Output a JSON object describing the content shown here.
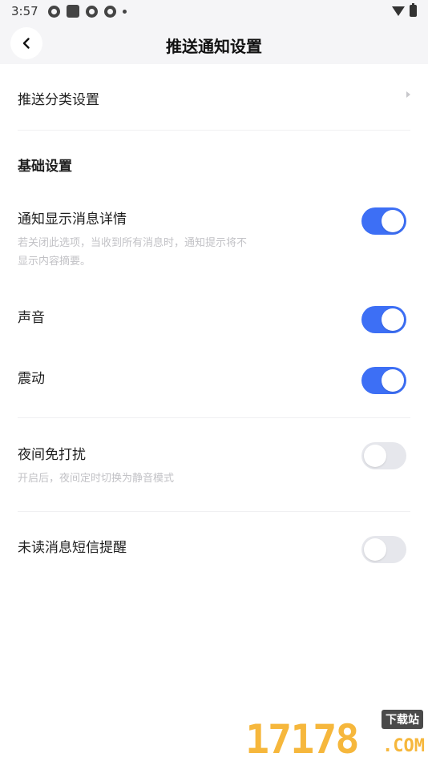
{
  "status_bar": {
    "time": "3:57"
  },
  "header": {
    "title": "推送通知设置"
  },
  "push_category": {
    "label": "推送分类设置"
  },
  "basic_section": {
    "title": "基础设置"
  },
  "settings": {
    "show_details": {
      "label": "通知显示消息详情",
      "desc": "若关闭此选项，当收到所有消息时，通知提示将不显示内容摘要。",
      "enabled": true
    },
    "sound": {
      "label": "声音",
      "enabled": true
    },
    "vibration": {
      "label": "震动",
      "enabled": true
    },
    "dnd": {
      "label": "夜间免打扰",
      "desc": "开启后，夜间定时切换为静音模式",
      "enabled": false
    },
    "sms_reminder": {
      "label": "未读消息短信提醒",
      "enabled": false
    }
  },
  "watermark": {
    "number": "17178",
    "badge": "下载站",
    "domain": ".COM"
  },
  "colors": {
    "accent": "#3d6ff5",
    "toggle_off": "#e6e7ec",
    "header_bg": "#f5f5f7"
  }
}
